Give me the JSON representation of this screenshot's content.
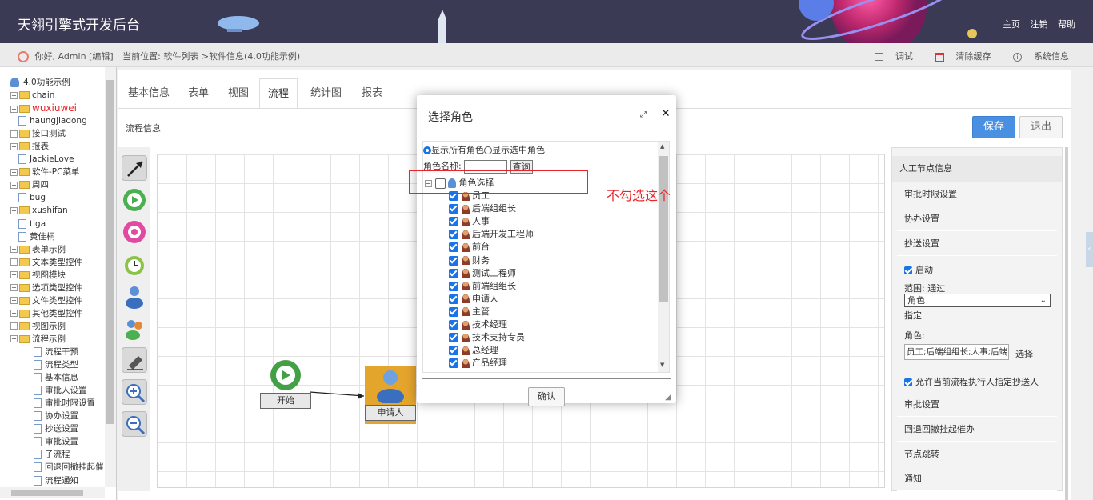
{
  "header": {
    "title": "天翎引擎式开发后台",
    "links": [
      "主页",
      "注销",
      "帮助"
    ]
  },
  "subbar": {
    "greeting": "你好, Admin [编辑]",
    "location": "当前位置: 软件列表 >软件信息(4.0功能示例)",
    "actions": [
      "调试",
      "清除缓存",
      "系统信息"
    ]
  },
  "sidebar": {
    "root": "4.0功能示例",
    "items": [
      {
        "label": "chain",
        "kind": "folder"
      },
      {
        "label": "wuxiuwei",
        "kind": "folder",
        "highlight": true
      },
      {
        "label": "haungjiadong",
        "kind": "page"
      },
      {
        "label": "接口测试",
        "kind": "folder"
      },
      {
        "label": "报表",
        "kind": "folder"
      },
      {
        "label": "JackieLove",
        "kind": "page"
      },
      {
        "label": "软件-PC菜单",
        "kind": "folder"
      },
      {
        "label": "周四",
        "kind": "folder"
      },
      {
        "label": "bug",
        "kind": "page"
      },
      {
        "label": "xushifan",
        "kind": "folder"
      },
      {
        "label": "tiga",
        "kind": "page"
      },
      {
        "label": "黄佳桐",
        "kind": "page"
      },
      {
        "label": "表单示例",
        "kind": "folder"
      },
      {
        "label": "文本类型控件",
        "kind": "folder"
      },
      {
        "label": "视图模块",
        "kind": "folder"
      },
      {
        "label": "选项类型控件",
        "kind": "folder"
      },
      {
        "label": "文件类型控件",
        "kind": "folder"
      },
      {
        "label": "其他类型控件",
        "kind": "folder"
      },
      {
        "label": "视图示例",
        "kind": "folder"
      },
      {
        "label": "流程示例",
        "kind": "folder",
        "open": true
      }
    ],
    "children": [
      "流程干预",
      "流程类型",
      "基本信息",
      "审批人设置",
      "审批时限设置",
      "协办设置",
      "抄送设置",
      "审批设置",
      "子流程",
      "回退回撤挂起催",
      "流程通知"
    ]
  },
  "tabs": [
    "基本信息",
    "表单",
    "视图",
    "流程",
    "统计图",
    "报表"
  ],
  "active_tab": "流程",
  "section_label": "流程信息",
  "buttons": {
    "save": "保存",
    "exit": "退出"
  },
  "flow": {
    "start": "开始",
    "applicant": "申请人"
  },
  "right_panel": {
    "header": "人工节点信息",
    "rows_top": [
      "审批时限设置",
      "协办设置",
      "抄送设置"
    ],
    "enable": "启动",
    "scope_label": "范围: 通过",
    "scope_value": "角色",
    "assign": "指定",
    "role_label": "角色:",
    "role_value": "员工;后端组组长;人事;后端",
    "select": "选择",
    "allow": "允许当前流程执行人指定抄送人",
    "rows_bottom": [
      "审批设置",
      "回退回撤挂起催办",
      "节点跳转",
      "通知"
    ]
  },
  "modal": {
    "title": "选择角色",
    "show_all": "显示所有角色",
    "show_selected": "显示选中角色",
    "name_label": "角色名称:",
    "query": "查询",
    "root": "角色选择",
    "roles": [
      "员工",
      "后端组组长",
      "人事",
      "后端开发工程师",
      "前台",
      "财务",
      "测试工程师",
      "前端组组长",
      "申请人",
      "主管",
      "技术经理",
      "技术支持专员",
      "总经理",
      "产品经理"
    ],
    "confirm": "确认"
  },
  "annotation": "不勾选这个"
}
